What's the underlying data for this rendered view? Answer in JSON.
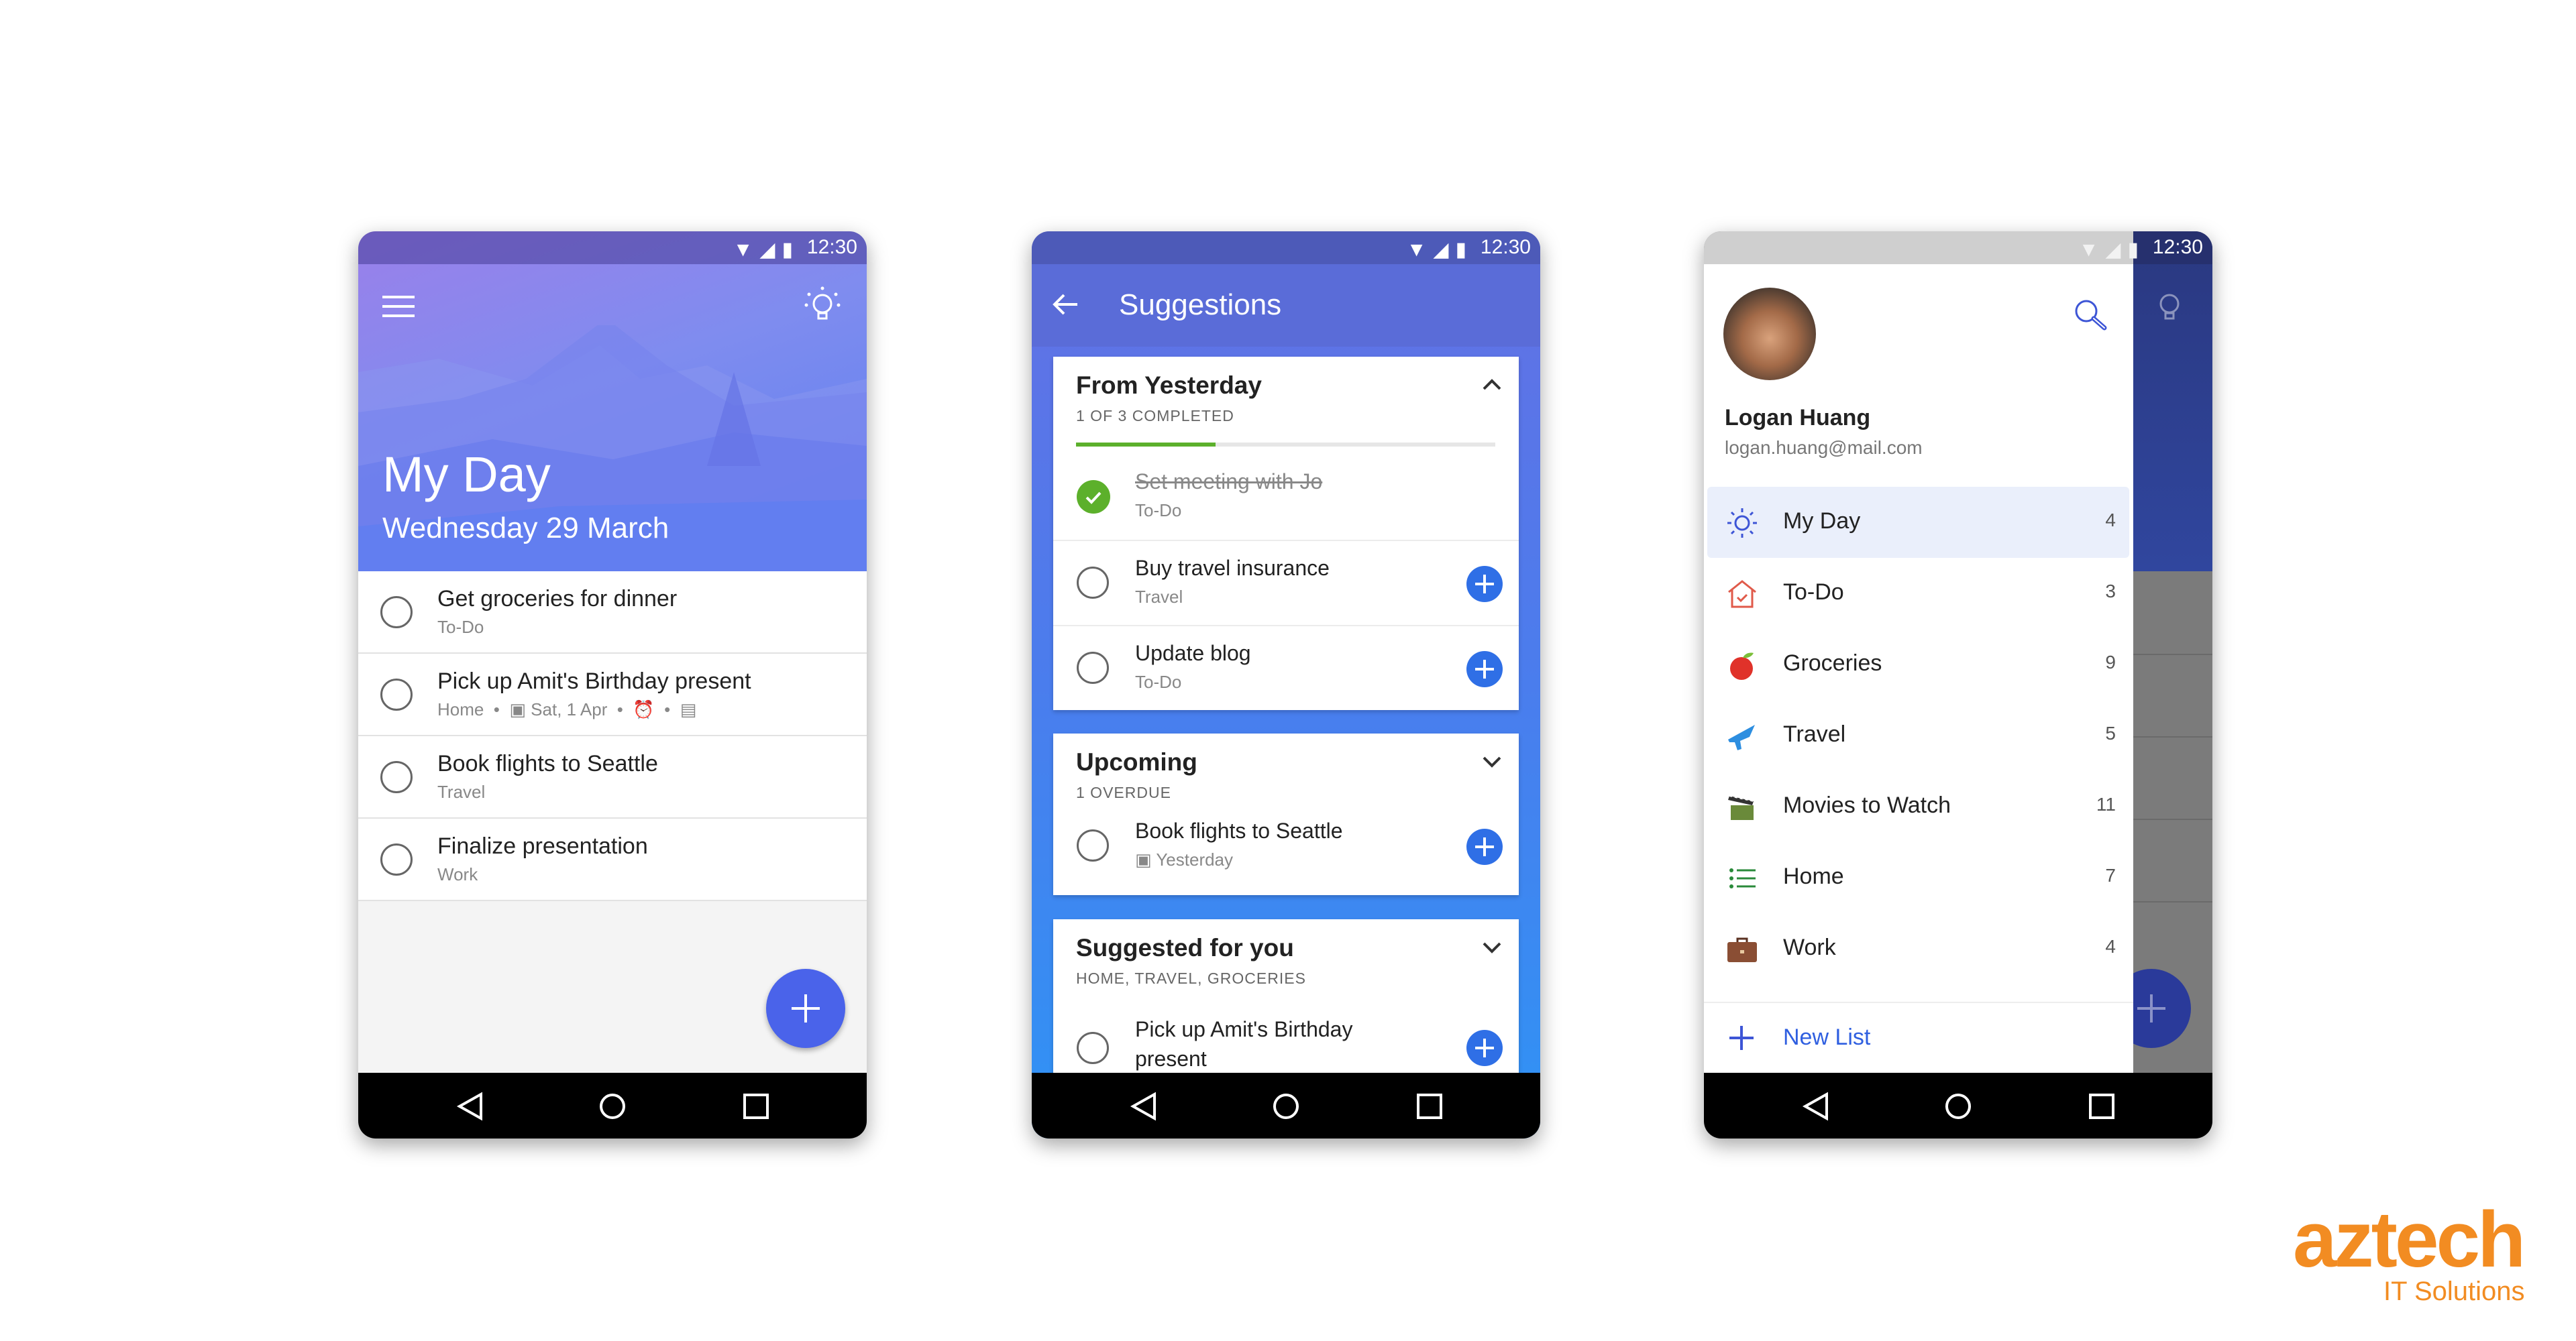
{
  "status_bar": {
    "time": "12:30"
  },
  "my_day": {
    "title": "My Day",
    "date": "Wednesday 29 March",
    "tasks": [
      {
        "title": "Get groceries for dinner",
        "list": "To-Do"
      },
      {
        "title": "Pick up Amit's Birthday present",
        "list": "Home",
        "due": "Sat, 1 Apr"
      },
      {
        "title": "Book flights to Seattle",
        "list": "Travel"
      },
      {
        "title": "Finalize presentation",
        "list": "Work"
      }
    ]
  },
  "suggestions": {
    "title": "Suggestions",
    "from_yesterday": {
      "title": "From Yesterday",
      "subtitle": "1 OF 3 COMPLETED",
      "progress": 0.333,
      "items": [
        {
          "title": "Set meeting with Jo",
          "list": "To-Do",
          "completed": true
        },
        {
          "title": "Buy travel insurance",
          "list": "Travel"
        },
        {
          "title": "Update blog",
          "list": "To-Do"
        }
      ]
    },
    "upcoming": {
      "title": "Upcoming",
      "subtitle": "1 OVERDUE",
      "items": [
        {
          "title": "Book flights to Seattle",
          "due": "Yesterday"
        }
      ]
    },
    "suggested": {
      "title": "Suggested for you",
      "subtitle": "HOME, TRAVEL, GROCERIES",
      "items": [
        {
          "title": "Pick up Amit's Birthday present"
        }
      ]
    }
  },
  "drawer": {
    "user_name": "Logan Huang",
    "email": "logan.huang@mail.com",
    "lists": [
      {
        "label": "My Day",
        "count": "4",
        "icon": "sun-icon"
      },
      {
        "label": "To-Do",
        "count": "3",
        "icon": "house-icon"
      },
      {
        "label": "Groceries",
        "count": "9",
        "icon": "apple-icon"
      },
      {
        "label": "Travel",
        "count": "5",
        "icon": "airplane-icon"
      },
      {
        "label": "Movies to Watch",
        "count": "11",
        "icon": "clapperboard-icon"
      },
      {
        "label": "Home",
        "count": "7",
        "icon": "list-icon"
      },
      {
        "label": "Work",
        "count": "4",
        "icon": "briefcase-icon"
      }
    ],
    "new_list": "New List"
  },
  "logo": {
    "name": "aztech",
    "tagline": "IT Solutions"
  },
  "colors": {
    "accent": "#2f6fe6",
    "green": "#5cb02b",
    "logo": "#f28c22"
  }
}
